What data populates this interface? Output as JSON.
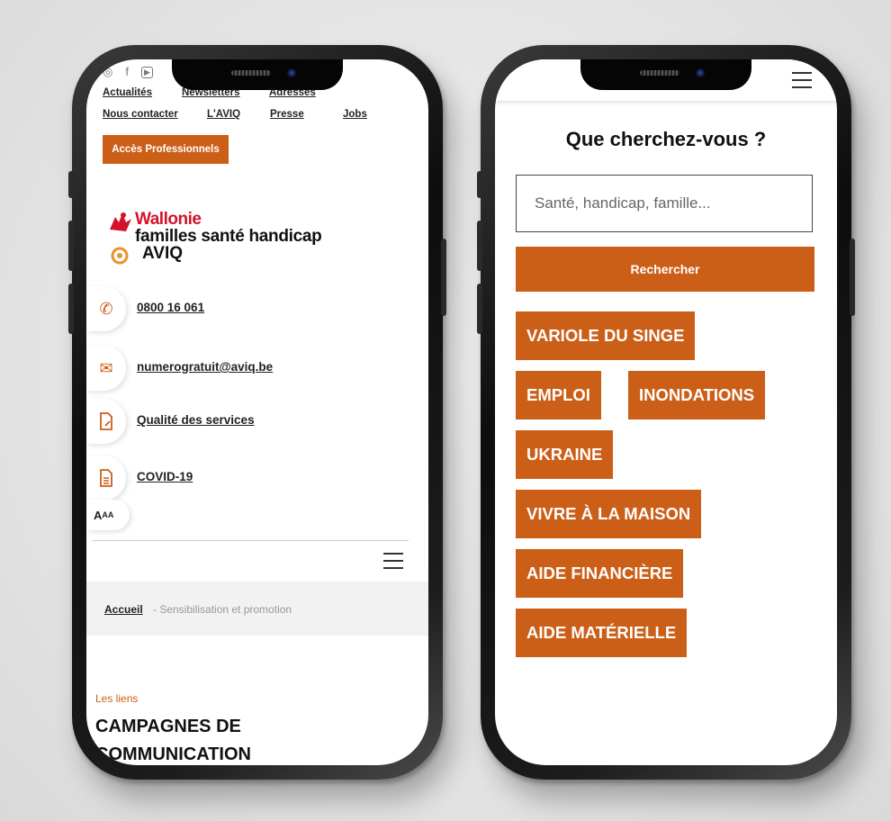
{
  "left_phone": {
    "social_icons": [
      "instagram-icon",
      "facebook-icon",
      "youtube-icon"
    ],
    "top_links_row1": [
      "Actualités",
      "Newsletters",
      "Adresses"
    ],
    "top_links_row2": [
      "Nous contacter",
      "L'AVIQ",
      "Presse",
      "Jobs"
    ],
    "pro_button": "Accès Professionnels",
    "logo": {
      "line1": "Wallonie",
      "line2": "familles santé handicap",
      "line3": "AVIQ"
    },
    "contacts": [
      {
        "icon": "phone-icon",
        "label": "0800 16 061"
      },
      {
        "icon": "envelope-icon",
        "label": "numerogratuit@aviq.be"
      },
      {
        "icon": "document-edit-icon",
        "label": "Qualité des services"
      },
      {
        "icon": "document-icon",
        "label": "COVID-19"
      }
    ],
    "font_size_toggle": {
      "big": "A",
      "small": "AA"
    },
    "breadcrumb": {
      "home": "Accueil",
      "current": "- Sensibilisation et promotion"
    },
    "section_label": "Les liens",
    "section_title": "CAMPAGNES DE COMMUNICATION"
  },
  "right_phone": {
    "title": "Que cherchez-vous ?",
    "search_placeholder": "Santé, handicap, famille...",
    "search_button": "Rechercher",
    "tags": [
      "VARIOLE DU SINGE",
      "EMPLOI",
      "INONDATIONS",
      "UKRAINE",
      "VIVRE À LA MAISON",
      "AIDE FINANCIÈRE",
      "AIDE MATÉRIELLE"
    ]
  },
  "colors": {
    "accent": "#cc5f18",
    "brand_red": "#d4122a",
    "breadcrumb_bg": "#f2f2f2"
  }
}
